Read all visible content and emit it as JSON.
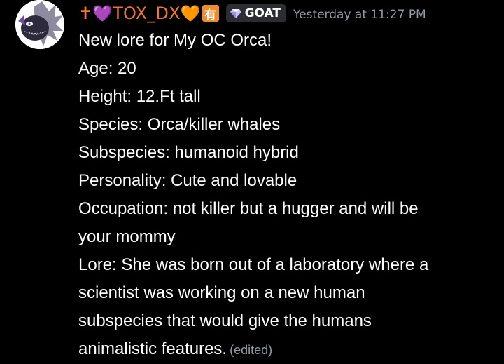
{
  "author": {
    "prefix_symbol": "✝",
    "heart_left": "💜",
    "name": "TOX_DX",
    "heart_right": "🧡",
    "badge_char": "有"
  },
  "tag": {
    "icon": "gem-icon",
    "label": "GOAT"
  },
  "timestamp": "Yesterday at 11:27 PM",
  "message": {
    "lines": [
      "New lore for My OC Orca!",
      "Age: 20",
      "Height: 12.Ft tall",
      "Species: Orca/killer whales",
      "Subspecies: humanoid hybrid",
      "Personality: Cute and lovable",
      "Occupation: not killer but a hugger and will be",
      "your mommy",
      "Lore: She was born out of a laboratory where a",
      "scientist was working on a new human",
      "subspecies that would give the humans",
      "animalistic features."
    ],
    "edited_label": "(edited)"
  },
  "colors": {
    "background": "#000000",
    "username": "#f0752a",
    "timestamp": "#949ba4",
    "text": "#ffffff",
    "tag_bg": "#2b2d31"
  }
}
